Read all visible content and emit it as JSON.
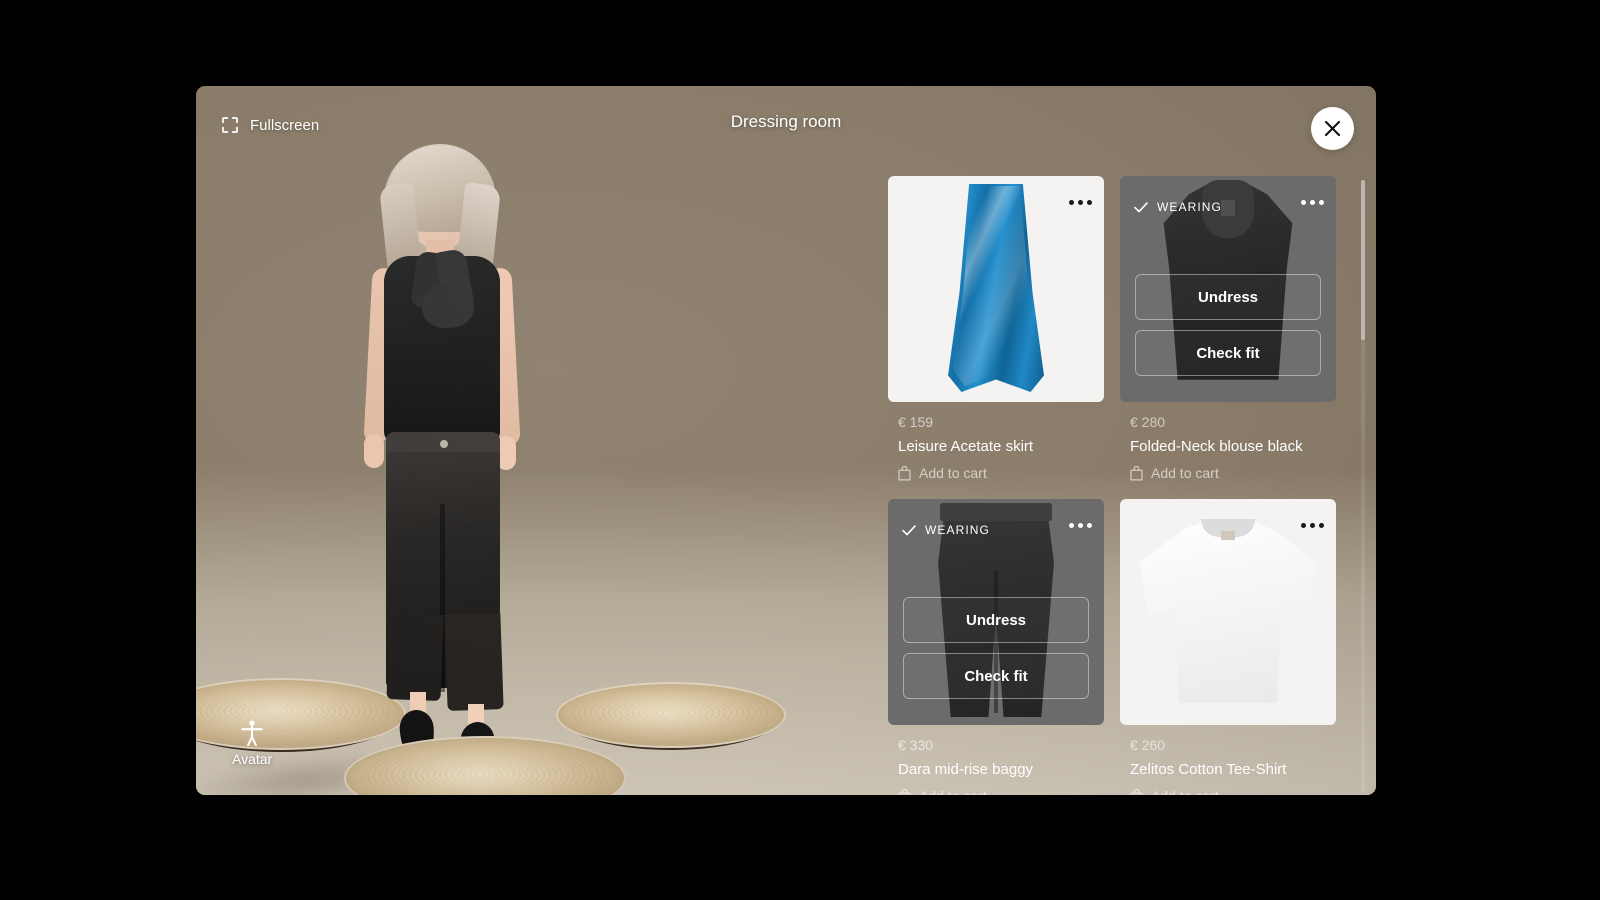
{
  "header": {
    "fullscreen_label": "Fullscreen",
    "fullscreen_icon": "expand-fullscreen-icon",
    "title": "Dressing room",
    "close_icon": "close-x-icon"
  },
  "viewer": {
    "avatar_label": "Avatar",
    "avatar_icon": "person-avatar-icon"
  },
  "actions": {
    "undress_label": "Undress",
    "check_fit_label": "Check fit",
    "add_to_cart_label": "Add to cart",
    "add_to_cart_icon": "shopping-bag-icon",
    "wearing_label": "WEARING",
    "wearing_icon": "check-icon",
    "more_icon": "more-horizontal-icon"
  },
  "colors": {
    "worn_overlay": "#6b6b6b",
    "card_bg": "#f4f3f1",
    "accent_white": "#ffffff",
    "price_text": "rgba(255,255,255,0.62)"
  },
  "products": [
    {
      "price": "€ 159",
      "name": "Leisure Acetate skirt",
      "wearing": false,
      "art": "skirt-blue"
    },
    {
      "price": "€ 280",
      "name": "Folded-Neck blouse black",
      "wearing": true,
      "art": "blouse-black"
    },
    {
      "price": "€ 330",
      "name": "Dara mid-rise baggy",
      "wearing": true,
      "art": "jeans-black"
    },
    {
      "price": "€ 260",
      "name": "Zelitos Cotton Tee-Shirt",
      "wearing": false,
      "art": "tee-white"
    }
  ]
}
